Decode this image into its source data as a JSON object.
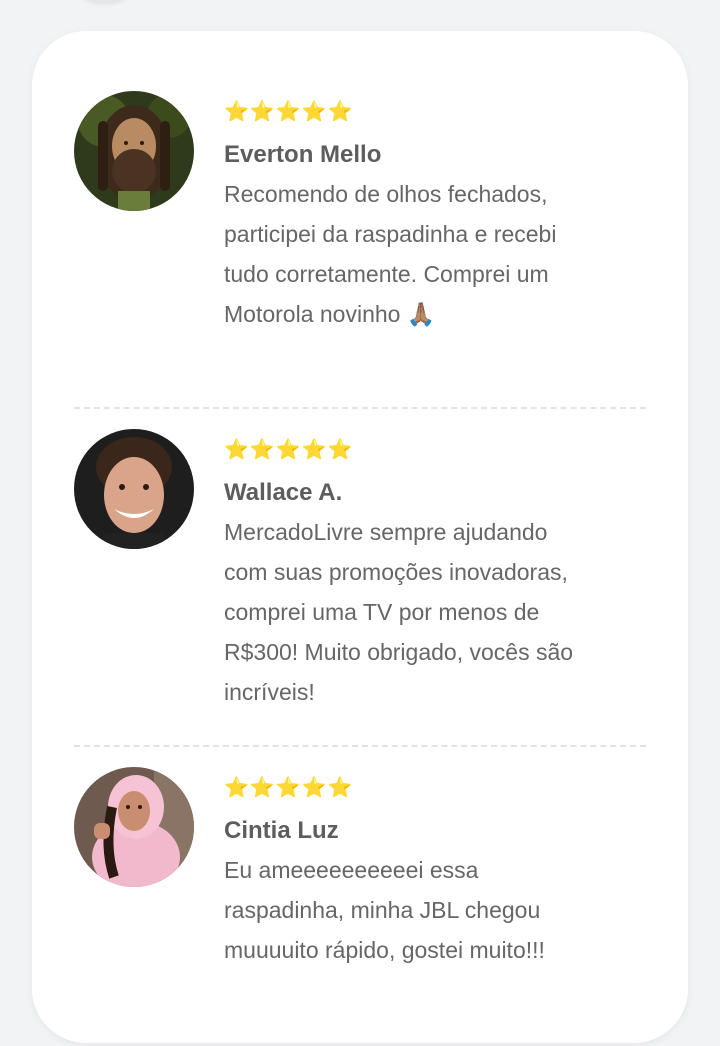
{
  "reviews": [
    {
      "stars": "⭐⭐⭐⭐⭐",
      "name": "Everton Mello",
      "text": "Recomendo de olhos fechados, participei da raspadinha e recebi tudo corretamente. Comprei um Motorola novinho 🙏🏽",
      "avatar": "avatar-man-dreadlocks"
    },
    {
      "stars": "⭐⭐⭐⭐⭐",
      "name": "Wallace A.",
      "text": "MercadoLivre sempre ajudando com suas promoções inovadoras, comprei uma TV por menos de R$300! Muito obrigado, vocês são incríveis!",
      "avatar": "avatar-man-smiling"
    },
    {
      "stars": "⭐⭐⭐⭐⭐",
      "name": "Cintia Luz",
      "text": "Eu ameeeeeeeeeei essa raspadinha, minha JBL chegou muuuuito rápido, gostei muito!!!",
      "avatar": "avatar-woman-pink-hoodie"
    }
  ],
  "colors": {
    "stars": "#f2c94c",
    "name": "#5d5d5d",
    "text": "#666666",
    "card": "#ffffff",
    "background": "#f2f3f5"
  }
}
